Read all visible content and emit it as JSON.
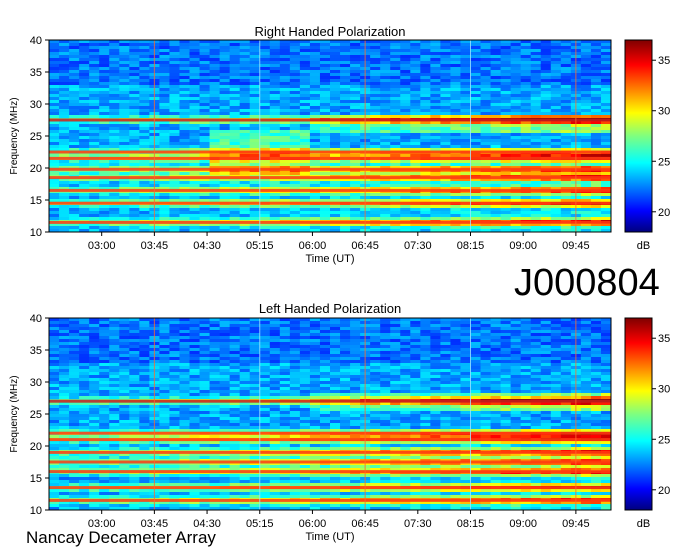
{
  "figure": {
    "observation_id": "J000804",
    "instrument": "Nancay Decameter Array"
  },
  "chart_data": [
    {
      "type": "heatmap",
      "title": "Right Handed Polarization",
      "xlabel": "Time (UT)",
      "ylabel": "Frequency (MHz)",
      "x_ticks": [
        "03:00",
        "03:45",
        "04:30",
        "05:15",
        "06:00",
        "06:45",
        "07:30",
        "08:15",
        "09:00",
        "09:45"
      ],
      "y_ticks": [
        10,
        15,
        20,
        25,
        30,
        35,
        40
      ],
      "ylim": [
        10,
        40
      ],
      "xlim": [
        "02:15",
        "10:15"
      ],
      "colorbar": {
        "label": "dB",
        "ticks": [
          20,
          25,
          30,
          35
        ],
        "range": [
          18,
          37
        ]
      },
      "emission_bands_mhz": [
        11.5,
        14.5,
        16.5,
        18.5,
        19.8,
        21.5,
        22.5,
        27.5
      ],
      "grid": false
    },
    {
      "type": "heatmap",
      "title": "Left Handed Polarization",
      "xlabel": "Time (UT)",
      "ylabel": "Frequency (MHz)",
      "x_ticks": [
        "03:00",
        "03:45",
        "04:30",
        "05:15",
        "06:00",
        "06:45",
        "07:30",
        "08:15",
        "09:00",
        "09:45"
      ],
      "y_ticks": [
        10,
        15,
        20,
        25,
        30,
        35,
        40
      ],
      "ylim": [
        10,
        40
      ],
      "xlim": [
        "02:15",
        "10:15"
      ],
      "colorbar": {
        "label": "dB",
        "ticks": [
          20,
          25,
          30,
          35
        ],
        "range": [
          18,
          37
        ]
      },
      "emission_bands_mhz": [
        11.5,
        13.5,
        16.0,
        17.5,
        19.0,
        21.0,
        22.0,
        27.0
      ],
      "grid": false
    }
  ]
}
